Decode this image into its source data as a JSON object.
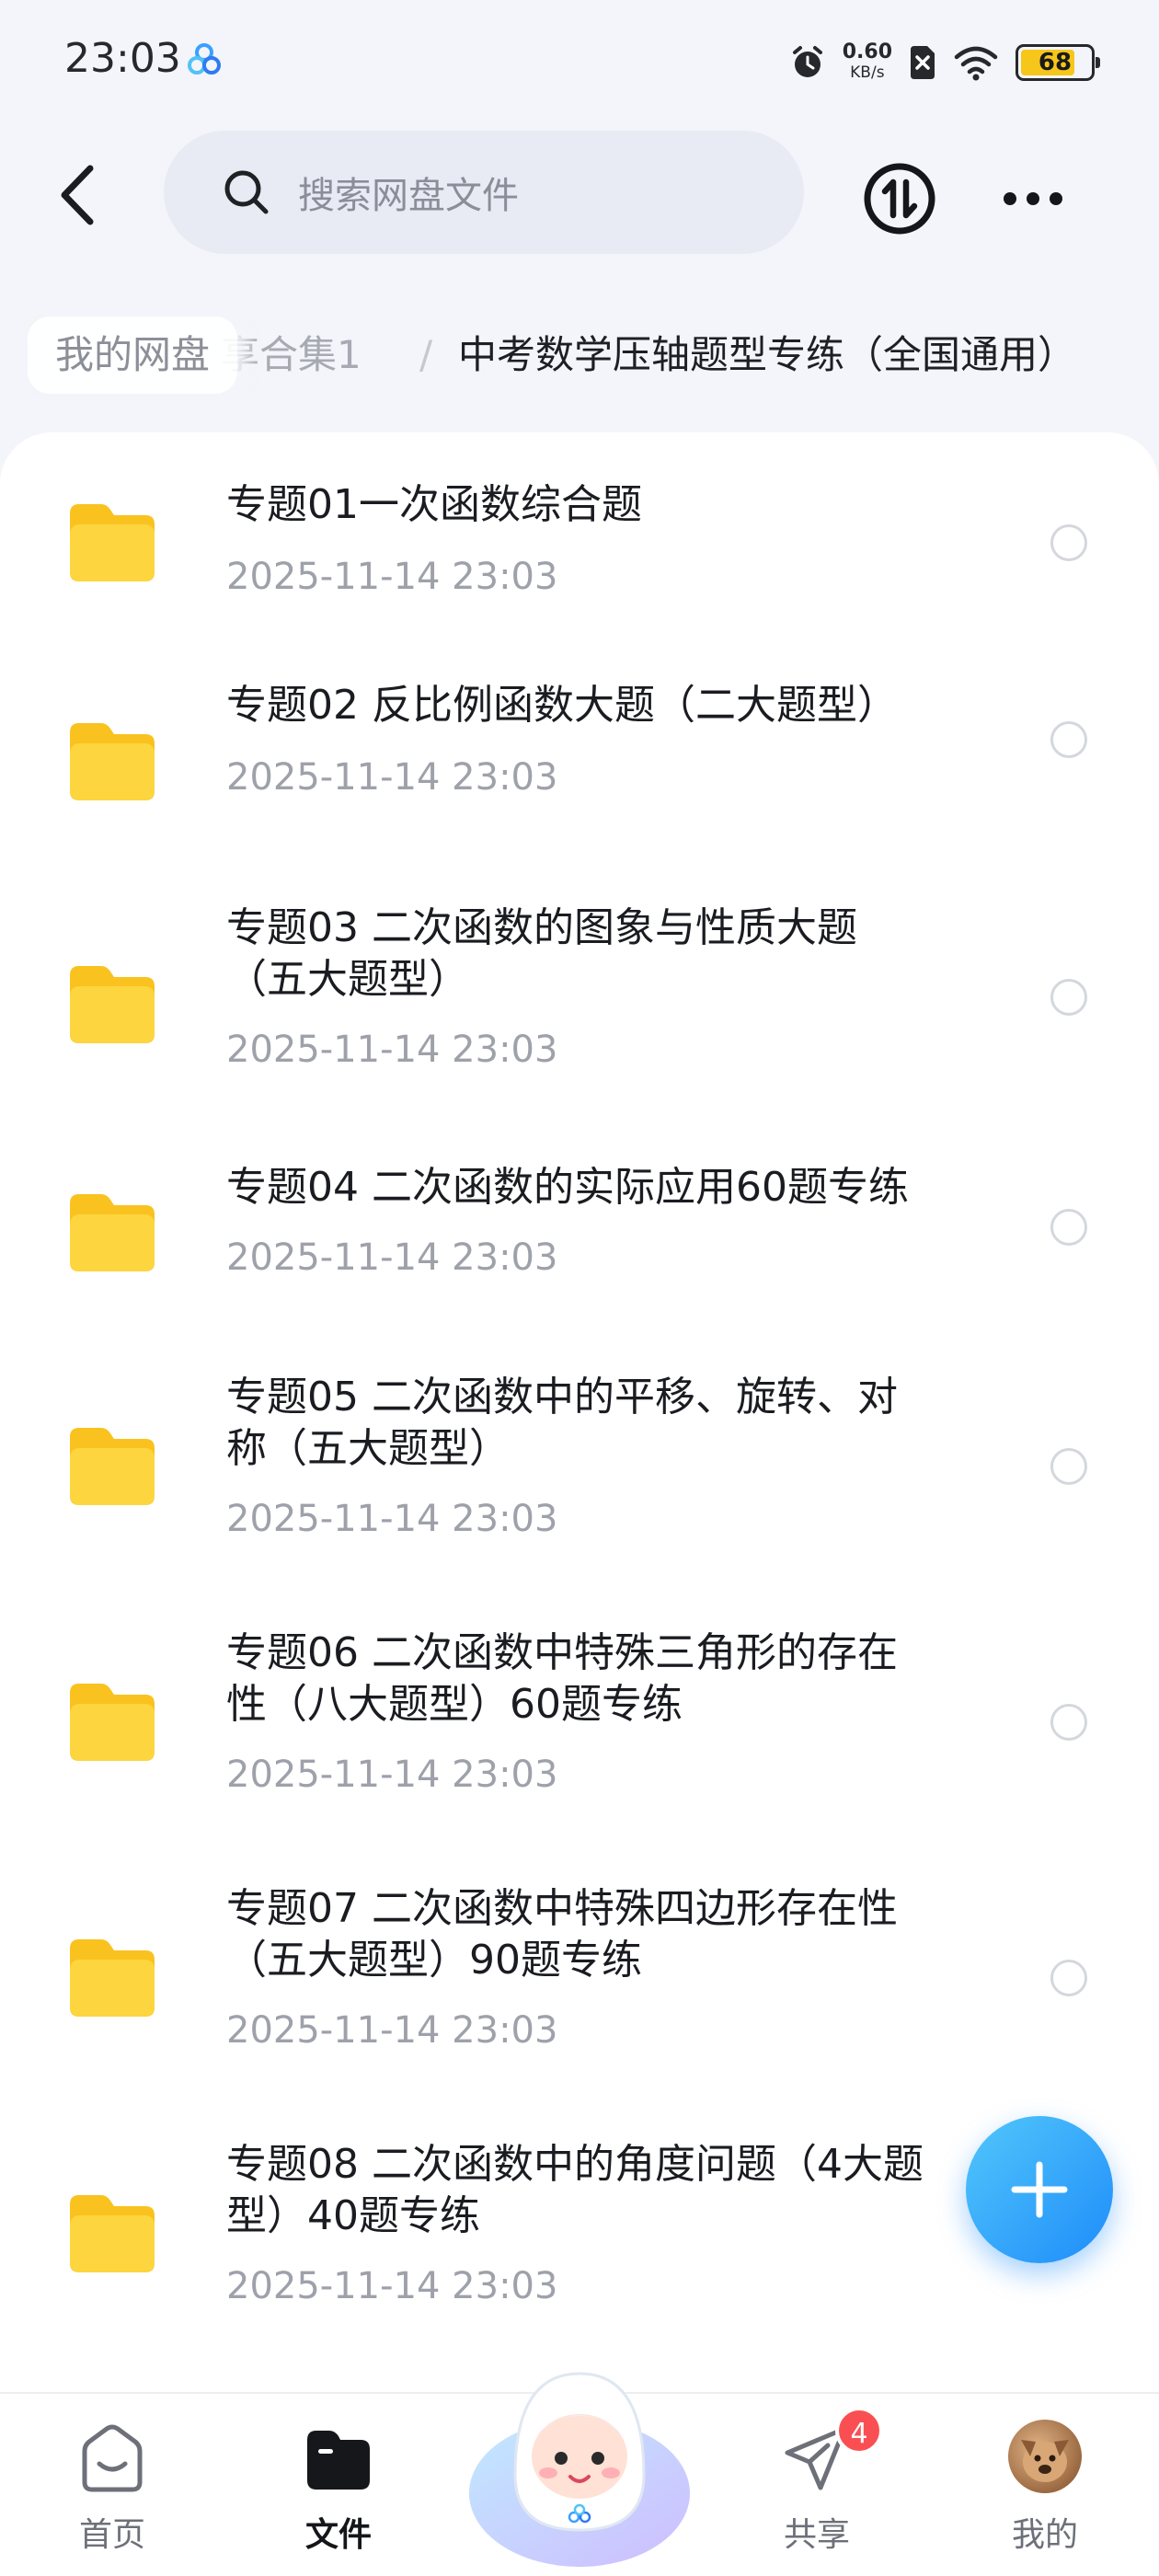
{
  "status_bar": {
    "time": "23:03",
    "net_speed_value": "0.60",
    "net_speed_unit": "KB/s",
    "battery_level": "68",
    "icons": [
      "alarm-icon",
      "sim-blocked-icon",
      "wifi-icon",
      "battery-icon"
    ]
  },
  "header": {
    "search_placeholder": "搜索网盘文件",
    "icons": [
      "back-arrow-icon",
      "search-icon",
      "sort-transfer-icon",
      "more-dots-icon"
    ]
  },
  "breadcrumb": {
    "root": "我的网盘",
    "middle": "享合集1",
    "separator": "/",
    "current": "中考数学压轴题型专练（全国通用）"
  },
  "files": [
    {
      "line1": "专题01一次函数综合题",
      "line2": "",
      "date": "2025-11-14  23:03"
    },
    {
      "line1": "专题02 反比例函数大题（二大题型）",
      "line2": "",
      "date": "2025-11-14  23:03"
    },
    {
      "line1": "专题03 二次函数的图象与性质大题",
      "line2": "（五大题型）",
      "date": "2025-11-14  23:03"
    },
    {
      "line1": "专题04 二次函数的实际应用60题专练",
      "line2": "",
      "date": "2025-11-14  23:03"
    },
    {
      "line1": "专题05 二次函数中的平移、旋转、对",
      "line2": "称（五大题型）",
      "date": "2025-11-14  23:03"
    },
    {
      "line1": "专题06 二次函数中特殊三角形的存在",
      "line2": "性（八大题型）60题专练",
      "date": "2025-11-14  23:03"
    },
    {
      "line1": "专题07 二次函数中特殊四边形存在性",
      "line2": "（五大题型）90题专练",
      "date": "2025-11-14  23:03"
    },
    {
      "line1": "专题08 二次函数中的角度问题（4大题",
      "line2": "型）40题专练",
      "date": "2025-11-14  23:03"
    }
  ],
  "fab": {
    "icon": "plus-icon"
  },
  "bottom_nav": {
    "home": "首页",
    "files": "文件",
    "share": "共享",
    "share_badge": "4",
    "mine": "我的"
  },
  "colors": {
    "accent": "#1e8cfa",
    "folder": "#fdd33b",
    "badge": "#fa4f52",
    "battery": "#f7c61b"
  }
}
